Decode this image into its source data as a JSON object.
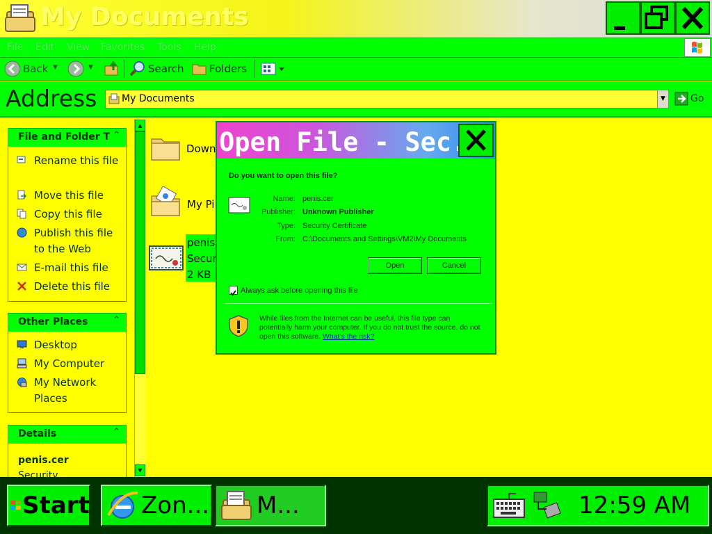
{
  "window": {
    "title": "My Documents",
    "controls": {
      "minimize": "minimize",
      "maximize": "maximize",
      "close": "close"
    }
  },
  "menu": [
    "File",
    "Edit",
    "View",
    "Favorites",
    "Tools",
    "Help"
  ],
  "toolbar": {
    "back_label": "Back",
    "search_label": "Search",
    "folders_label": "Folders"
  },
  "address": {
    "label": "Address",
    "value": "My Documents",
    "go_label": "Go"
  },
  "tasks_panel": {
    "title": "File and Folder T",
    "items": [
      {
        "label": "Rename this file",
        "icon": "rename-icon"
      },
      {
        "label": "Move this file",
        "icon": "move-icon"
      },
      {
        "label": "Copy this file",
        "icon": "copy-icon"
      },
      {
        "label": "Publish this file to the Web",
        "icon": "globe-icon"
      },
      {
        "label": "E-mail this file",
        "icon": "envelope-icon"
      },
      {
        "label": "Delete this file",
        "icon": "delete-x-icon"
      }
    ]
  },
  "other_places": {
    "title": "Other Places",
    "items": [
      {
        "label": "Desktop",
        "icon": "desktop-icon"
      },
      {
        "label": "My Computer",
        "icon": "computer-icon"
      },
      {
        "label": "My Network Places",
        "icon": "network-icon"
      }
    ]
  },
  "details": {
    "title": "Details",
    "filename": "penis.cer",
    "type_partial": "Security"
  },
  "files": [
    {
      "name": "Downl",
      "icon": "folder-icon"
    },
    {
      "name": "My Pi",
      "icon": "pictures-folder-icon"
    },
    {
      "name": "penis.",
      "line2": "Secur",
      "line3": "2 KB",
      "icon": "certificate-icon"
    }
  ],
  "dialog": {
    "title": "Open File - Sec...",
    "question": "Do you want to open this file?",
    "name_label": "Name:",
    "name_value": "penis.cer",
    "publisher_label": "Publisher:",
    "publisher_value": "Unknown Publisher",
    "type_label": "Type:",
    "type_value": "Security Certificate",
    "from_label": "From:",
    "from_value": "C:\\Documents and Settings\\VM2\\My Documents",
    "open_label": "Open",
    "cancel_label": "Cancel",
    "checkbox_label": "Always ask before opening this file",
    "checkbox_checked": true,
    "warning_line1": "While files from the Internet can be useful, this file type can",
    "warning_line2": "potentially harm your computer. If you do not trust the source, do not",
    "warning_line3": "open this software.",
    "risk_link": "What's the risk?"
  },
  "taskbar": {
    "start_label": "Start",
    "tasks": [
      {
        "label": "Zon...",
        "icon": "ie-icon"
      },
      {
        "label": "M...",
        "icon": "explorer-icon"
      }
    ],
    "clock": "12:59 AM"
  }
}
